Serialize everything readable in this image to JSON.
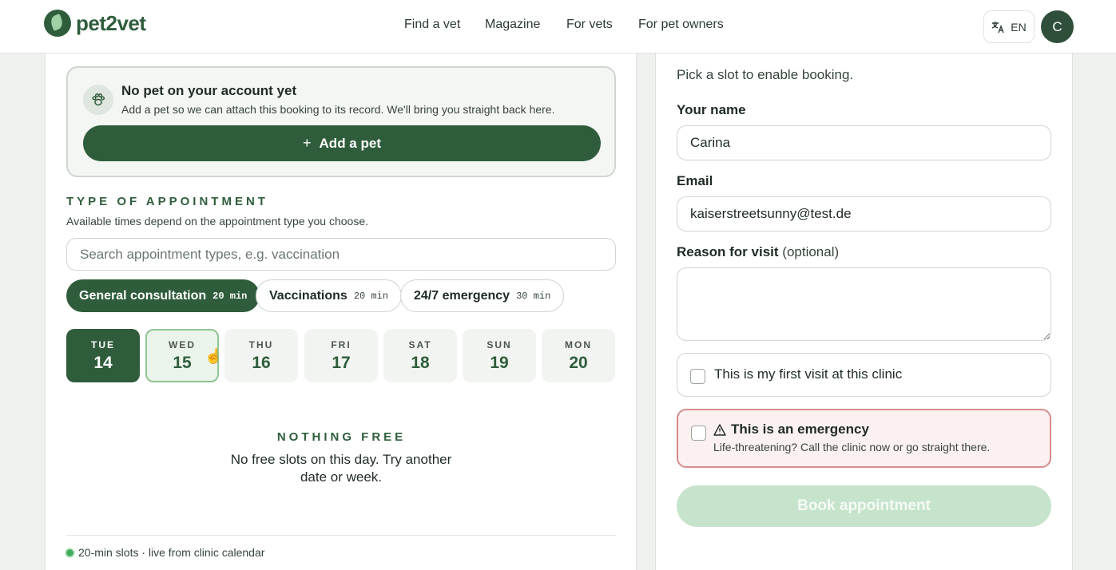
{
  "brand": {
    "name": "pet2vet"
  },
  "nav": {
    "find_vet": "Find a vet",
    "magazine": "Magazine",
    "for_vets": "For vets",
    "for_pet_owners": "For pet owners"
  },
  "lang": {
    "code": "EN",
    "icon": "translate-icon"
  },
  "user": {
    "initial": "C"
  },
  "pet_notice": {
    "icon": "paw-icon",
    "title": "No pet on your account yet",
    "subtitle": "Add a pet so we can attach this booking to its record. We'll bring you straight back here.",
    "add_label": "Add a pet"
  },
  "appointment_type": {
    "title": "TYPE OF APPOINTMENT",
    "subtitle": "Available times depend on the appointment type you choose.",
    "search_placeholder": "Search appointment types, e.g. vaccination",
    "types": [
      {
        "label": "General consultation",
        "duration": "20 min",
        "active": true
      },
      {
        "label": "Vaccinations",
        "duration": "20 min",
        "active": false
      },
      {
        "label": "24/7 emergency",
        "duration": "30 min",
        "active": false
      }
    ]
  },
  "days": [
    {
      "name": "TUE",
      "date": "14"
    },
    {
      "name": "WED",
      "date": "15"
    },
    {
      "name": "THU",
      "date": "16"
    },
    {
      "name": "FRI",
      "date": "17"
    },
    {
      "name": "SAT",
      "date": "18"
    },
    {
      "name": "SUN",
      "date": "19"
    },
    {
      "name": "MON",
      "date": "20"
    }
  ],
  "empty_state": {
    "title": "NOTHING FREE",
    "text": "No free slots on this day. Try another date or week."
  },
  "footer_note": "20-min slots · live from clinic calendar",
  "booking_form": {
    "hint": "Pick a slot to enable booking.",
    "name_label": "Your name",
    "name_value": "Carina",
    "email_label": "Email",
    "email_value": "kaiserstreetsunny@test.de",
    "reason_label": "Reason for visit",
    "reason_optional": "(optional)",
    "first_visit_label": "This is my first visit at this clinic",
    "emergency_title": "This is an emergency",
    "emergency_sub": "Life-threatening? Call the clinic now or go straight there.",
    "book_label": "Book appointment"
  },
  "colors": {
    "primary": "#2f5d3c",
    "accent_light": "#c6e3cb",
    "emergency_border": "#d88b8b",
    "live_dot": "#3fae5a"
  }
}
